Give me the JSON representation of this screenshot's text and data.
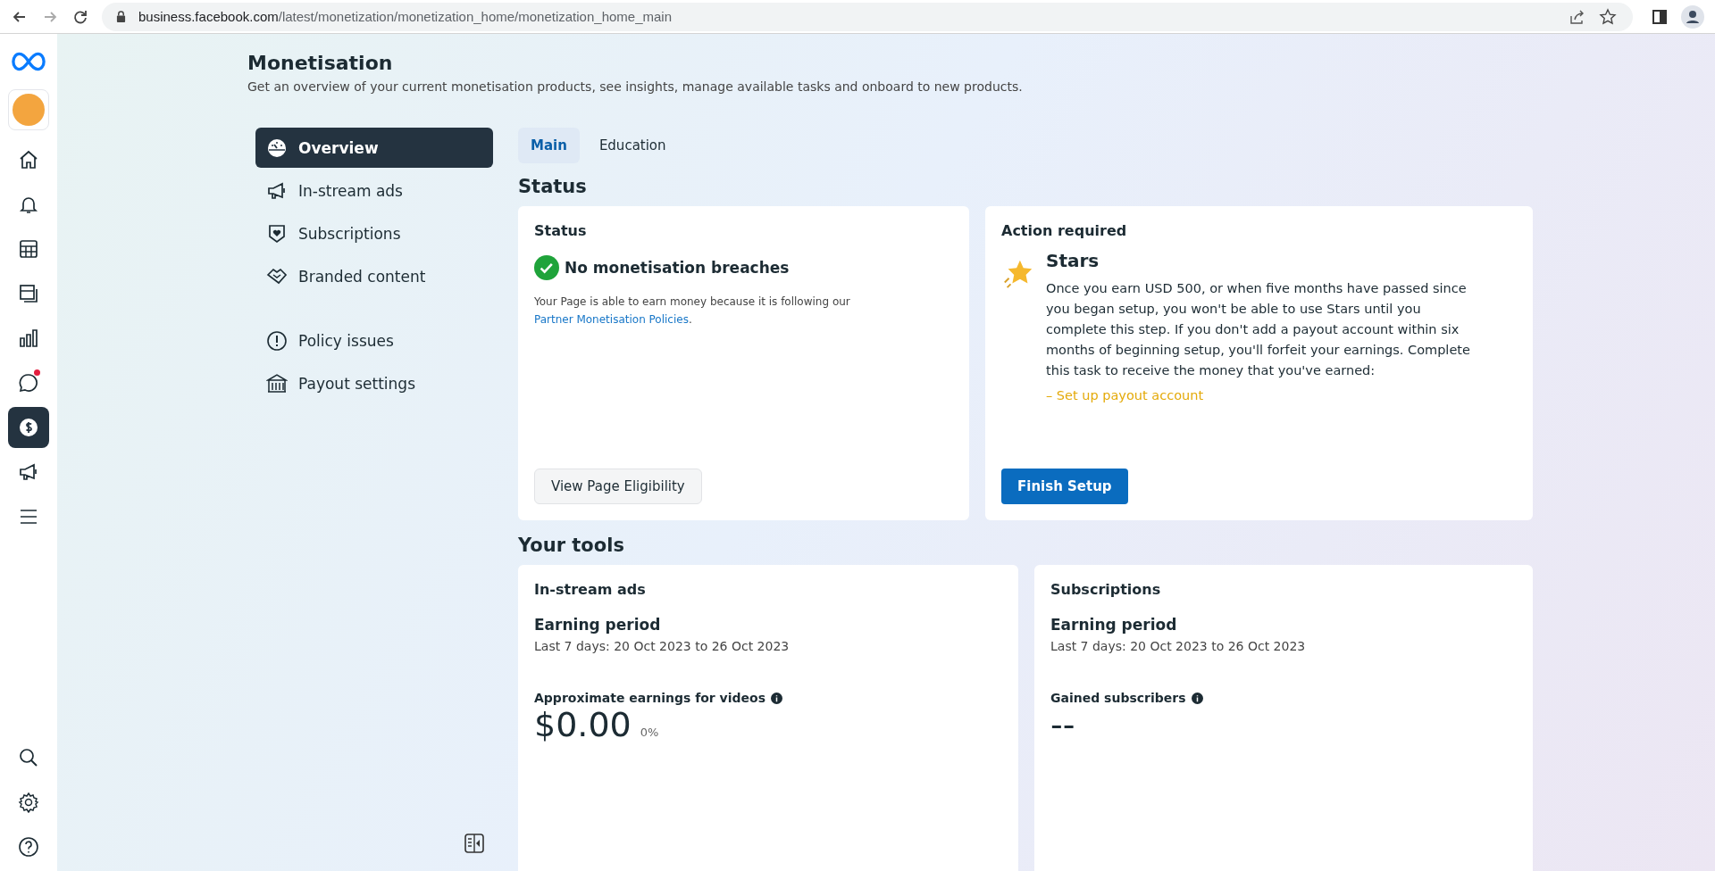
{
  "browser": {
    "url_host": "business.facebook.com",
    "url_path": "/latest/monetization/monetization_home/monetization_home_main"
  },
  "rail": {
    "top": [
      {
        "kind": "home",
        "selected": false,
        "dot": false
      },
      {
        "kind": "bell",
        "selected": false,
        "dot": false
      },
      {
        "kind": "table",
        "selected": false,
        "dot": false
      },
      {
        "kind": "pages",
        "selected": false,
        "dot": false
      },
      {
        "kind": "chart",
        "selected": false,
        "dot": false
      },
      {
        "kind": "chat",
        "selected": false,
        "dot": true
      },
      {
        "kind": "dollar",
        "selected": true,
        "dot": false
      },
      {
        "kind": "megaphone",
        "selected": false,
        "dot": false
      },
      {
        "kind": "menu",
        "selected": false,
        "dot": false
      }
    ],
    "bottom": [
      {
        "kind": "search"
      },
      {
        "kind": "settings"
      },
      {
        "kind": "help"
      }
    ]
  },
  "page": {
    "title": "Monetisation",
    "subtitle": "Get an overview of your current monetisation products, see insights, manage available tasks and onboard to new products."
  },
  "nav_groups": [
    [
      {
        "kind": "gauge",
        "label": "Overview",
        "selected": true
      },
      {
        "kind": "megaphone",
        "label": "In-stream ads",
        "selected": false
      },
      {
        "kind": "shield",
        "label": "Subscriptions",
        "selected": false
      },
      {
        "kind": "handshake",
        "label": "Branded content",
        "selected": false
      }
    ],
    [
      {
        "kind": "alert",
        "label": "Policy issues",
        "selected": false
      },
      {
        "kind": "bank",
        "label": "Payout settings",
        "selected": false
      }
    ]
  ],
  "tabs": [
    {
      "label": "Main",
      "selected": true
    },
    {
      "label": "Education",
      "selected": false
    }
  ],
  "status_section": {
    "heading": "Status",
    "status_card": {
      "title": "Status",
      "result": "No monetisation breaches",
      "text": "Your Page is able to earn money because it is following our",
      "link": "Partner Monetisation Policies",
      "after_link": ".",
      "button": "View Page Eligibility"
    },
    "action_card": {
      "title": "Action required",
      "item_title": "Stars",
      "text": "Once you earn USD 500, or when five months have passed since you began setup, you won't be able to use Stars until you complete this step. If you don't add a payout account within six months of beginning setup, you'll forfeit your earnings. Complete this task to receive the money that you've earned:",
      "task": "– Set up payout account",
      "button": "Finish Setup"
    }
  },
  "tools_section": {
    "heading": "Your tools",
    "cards": [
      {
        "title": "In-stream ads",
        "period_label": "Earning period",
        "period": "Last 7 days: 20 Oct 2023 to 26 Oct 2023",
        "metric_label": "Approximate earnings for videos",
        "metric_value": "$0.00",
        "metric_change": "0%"
      },
      {
        "title": "Subscriptions",
        "period_label": "Earning period",
        "period": "Last 7 days: 20 Oct 2023 to 26 Oct 2023",
        "metric_label": "Gained subscribers",
        "metric_value": "--"
      }
    ]
  }
}
